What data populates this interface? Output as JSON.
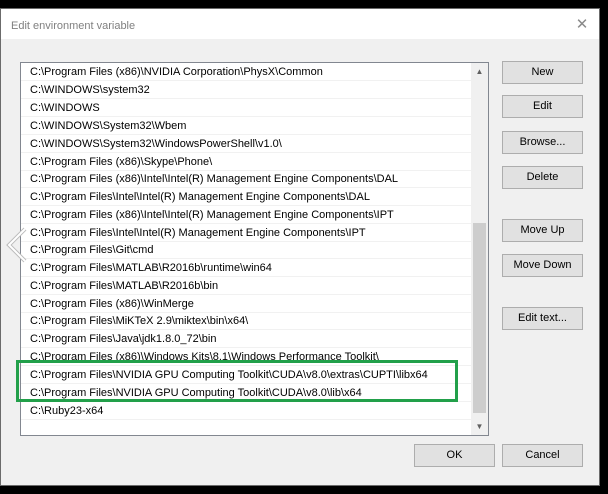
{
  "dialog": {
    "title": "Edit environment variable",
    "close_glyph": "✕"
  },
  "list": {
    "items": [
      "C:\\Program Files (x86)\\NVIDIA Corporation\\PhysX\\Common",
      "C:\\WINDOWS\\system32",
      "C:\\WINDOWS",
      "C:\\WINDOWS\\System32\\Wbem",
      "C:\\WINDOWS\\System32\\WindowsPowerShell\\v1.0\\",
      "C:\\Program Files (x86)\\Skype\\Phone\\",
      "C:\\Program Files (x86)\\Intel\\Intel(R) Management Engine Components\\DAL",
      "C:\\Program Files\\Intel\\Intel(R) Management Engine Components\\DAL",
      "C:\\Program Files (x86)\\Intel\\Intel(R) Management Engine Components\\IPT",
      "C:\\Program Files\\Intel\\Intel(R) Management Engine Components\\IPT",
      "C:\\Program Files\\Git\\cmd",
      "C:\\Program Files\\MATLAB\\R2016b\\runtime\\win64",
      "C:\\Program Files\\MATLAB\\R2016b\\bin",
      "C:\\Program Files (x86)\\WinMerge",
      "C:\\Program Files\\MiKTeX 2.9\\miktex\\bin\\x64\\",
      "C:\\Program Files\\Java\\jdk1.8.0_72\\bin",
      "C:\\Program Files (x86)\\Windows Kits\\8.1\\Windows Performance Toolkit\\",
      "C:\\Program Files\\NVIDIA GPU Computing Toolkit\\CUDA\\v8.0\\extras\\CUPTI\\libx64",
      "C:\\Program Files\\NVIDIA GPU Computing Toolkit\\CUDA\\v8.0\\lib\\x64",
      "C:\\Ruby23-x64"
    ],
    "scroll_up_glyph": "▲",
    "scroll_down_glyph": "▼"
  },
  "buttons": {
    "new": "New",
    "edit": "Edit",
    "browse": "Browse...",
    "delete": "Delete",
    "move_up": "Move Up",
    "move_down": "Move Down",
    "edit_text": "Edit text...",
    "ok": "OK",
    "cancel": "Cancel"
  },
  "colors": {
    "highlight_border": "#22a04a",
    "background": "#000000",
    "dialog_bg": "#f0f0f0"
  }
}
